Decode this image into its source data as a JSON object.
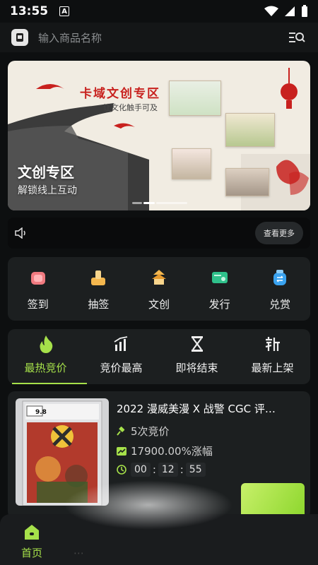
{
  "status_bar": {
    "time": "13:55",
    "badge": "A"
  },
  "search": {
    "placeholder": "输入商品名称"
  },
  "banner": {
    "art_title": "卡域文创专区",
    "art_subtitle": "让文化触手可及",
    "title": "文创专区",
    "subtitle": "解锁线上互动"
  },
  "notice": {
    "more_label": "查看更多"
  },
  "quick_menu": [
    {
      "label": "签到",
      "icon": "check-in-icon"
    },
    {
      "label": "抽签",
      "icon": "lottery-icon"
    },
    {
      "label": "文创",
      "icon": "pagoda-icon"
    },
    {
      "label": "发行",
      "icon": "release-icon"
    },
    {
      "label": "兑赏",
      "icon": "exchange-icon"
    }
  ],
  "tabs": [
    {
      "label": "最热竞价",
      "icon": "flame-icon",
      "active": true
    },
    {
      "label": "竞价最高",
      "icon": "bar-chart-icon",
      "active": false
    },
    {
      "label": "即将结束",
      "icon": "hourglass-icon",
      "active": false
    },
    {
      "label": "最新上架",
      "icon": "new-icon",
      "active": false
    }
  ],
  "auction_card": {
    "title": "2022 漫威美漫 X 战警 CGC 评…",
    "bids": "5次竞价",
    "change": "17900.00%涨幅",
    "timer": {
      "h": "00",
      "m": "12",
      "s": "55"
    },
    "grade": "9.8"
  },
  "bottom_nav": {
    "home_label": "首页"
  },
  "colors": {
    "accent": "#a6e14a",
    "card_bg": "#1c1f20",
    "page_bg": "#0d0f10"
  }
}
